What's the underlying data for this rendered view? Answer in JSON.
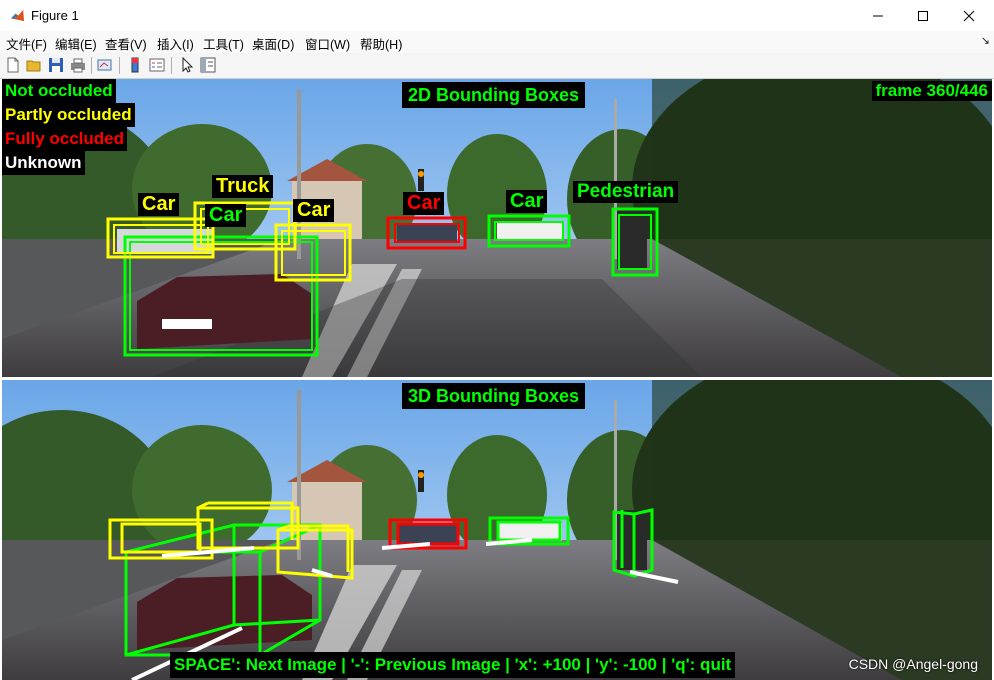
{
  "window": {
    "title": "Figure 1"
  },
  "menu": [
    "文件(F)",
    "编辑(E)",
    "查看(V)",
    "插入(I)",
    "工具(T)",
    "桌面(D)",
    "窗口(W)",
    "帮助(H)"
  ],
  "legend": {
    "not_occluded": "Not occluded",
    "partly_occluded": "Partly occluded",
    "fully_occluded": "Fully occluded",
    "unknown": "Unknown"
  },
  "colors": {
    "not_occluded": "#00ff00",
    "partly_occluded": "#ffff00",
    "fully_occluded": "#ff0000",
    "unknown": "#ffffff"
  },
  "panels": {
    "top_title": "2D Bounding Boxes",
    "bottom_title": "3D Bounding Boxes",
    "frame": "frame 360/446"
  },
  "labels": {
    "car_1": "Car",
    "truck": "Truck",
    "car_2": "Car",
    "car_3": "Car",
    "car_red": "Car",
    "car_green": "Car",
    "pedestrian": "Pedestrian"
  },
  "help_text": "SPACE': Next Image  |  '-': Previous Image  |  'x': +100  |  'y': -100  |  'q': quit",
  "watermark": "CSDN @Angel-gong"
}
